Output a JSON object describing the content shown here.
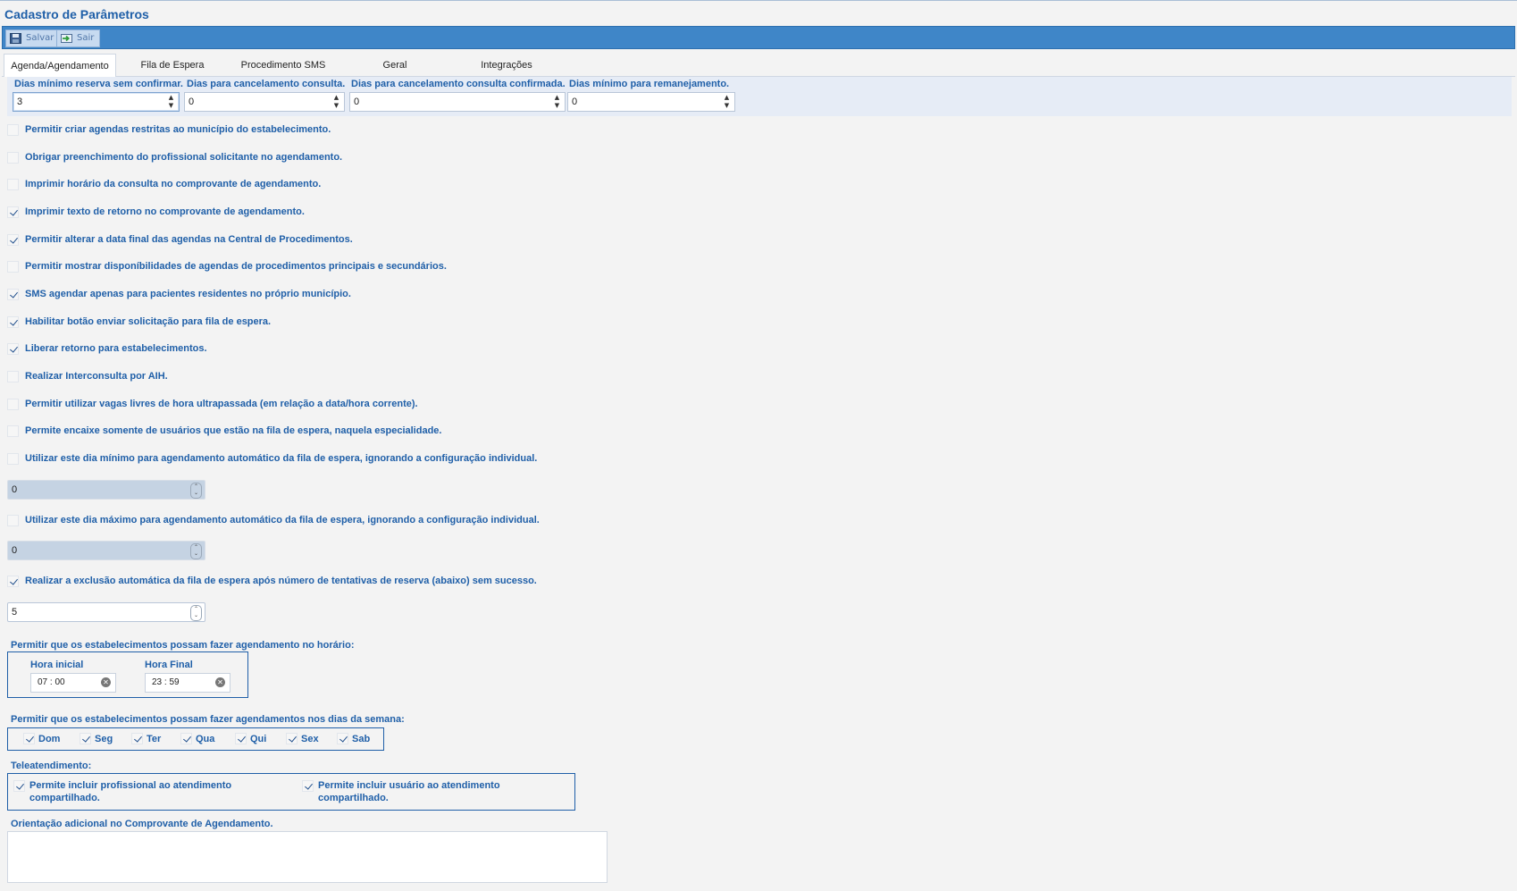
{
  "window": {
    "title": "Cadastro de Parâmetros"
  },
  "toolbar": {
    "save_label": "Salvar",
    "exit_label": "Sair"
  },
  "tabs": [
    {
      "label": "Agenda/Agendamento",
      "active": true
    },
    {
      "label": "Fila de Espera",
      "active": false
    },
    {
      "label": "Procedimento SMS",
      "active": false
    },
    {
      "label": "Geral",
      "active": false
    },
    {
      "label": "Integrações",
      "active": false
    }
  ],
  "params": {
    "min_reserve_label": "Dias mínimo reserva sem confirmar.",
    "min_reserve_value": "3",
    "cancel_label": "Dias para cancelamento consulta.",
    "cancel_value": "0",
    "cancel_confirmed_label": "Dias para cancelamento consulta confirmada.",
    "cancel_confirmed_value": "0",
    "relocation_label": "Dias mínimo para remanejamento.",
    "relocation_value": "0"
  },
  "options": [
    {
      "label": "Permitir criar agendas restritas ao município do estabelecimento.",
      "checked": false
    },
    {
      "label": "Obrigar preenchimento do profissional solicitante no agendamento.",
      "checked": false
    },
    {
      "label": "Imprimir horário da consulta no comprovante de agendamento.",
      "checked": false
    },
    {
      "label": "Imprimir texto de retorno no comprovante de agendamento.",
      "checked": true
    },
    {
      "label": "Permitir alterar a data final das agendas na Central de Procedimentos.",
      "checked": true
    },
    {
      "label": "Permitir mostrar disponíbilidades de agendas de procedimentos principais e secundários.",
      "checked": false
    },
    {
      "label": "SMS agendar apenas para pacientes residentes no próprio município.",
      "checked": true
    },
    {
      "label": "Habilitar botão enviar solicitação para fila de espera.",
      "checked": true
    },
    {
      "label": "Liberar retorno para estabelecimentos.",
      "checked": true
    },
    {
      "label": "Realizar Interconsulta por AIH.",
      "checked": false
    },
    {
      "label": "Permitir utilizar vagas livres de hora ultrapassada (em relação a data/hora corrente).",
      "checked": false
    },
    {
      "label": "Permite encaixe somente de usuários que estão na fila de espera, naquela especialidade.",
      "checked": false
    }
  ],
  "auto_min": {
    "label": "Utilizar este dia mínimo para agendamento automático da fila de espera, ignorando a configuração individual.",
    "checked": false,
    "value": "0"
  },
  "auto_max": {
    "label": "Utilizar este dia máximo para agendamento automático da fila de espera, ignorando a configuração individual.",
    "checked": false,
    "value": "0"
  },
  "auto_exclude": {
    "label": "Realizar a exclusão automática da fila de espera após número de tentativas de reserva (abaixo) sem sucesso.",
    "checked": true,
    "value": "5"
  },
  "schedule_hours": {
    "label": "Permitir que os estabelecimentos possam fazer agendamento no horário:",
    "start_label": "Hora inicial",
    "start_value": "07 : 00",
    "end_label": "Hora Final",
    "end_value": "23 : 59"
  },
  "weekdays": {
    "label": "Permitir que os estabelecimentos possam fazer agendamentos nos dias da semana:",
    "days": [
      {
        "label": "Dom",
        "checked": true
      },
      {
        "label": "Seg",
        "checked": true
      },
      {
        "label": "Ter",
        "checked": true
      },
      {
        "label": "Qua",
        "checked": true
      },
      {
        "label": "Qui",
        "checked": true
      },
      {
        "label": "Sex",
        "checked": true
      },
      {
        "label": "Sab",
        "checked": true
      }
    ]
  },
  "teleatendimento": {
    "label": "Teleatendimento:",
    "professional_line1": "Permite incluir profissional ao atendimento",
    "professional_line2": "compartilhado.",
    "professional_checked": true,
    "user_line1": "Permite incluir usuário ao atendimento",
    "user_line2": "compartilhado.",
    "user_checked": true
  },
  "orientation": {
    "label": "Orientação adicional no Comprovante de Agendamento.",
    "value": ""
  },
  "colors": {
    "toolbar": "#3f86c8",
    "label_blue": "#1f5fa8",
    "panel_bg": "#f3f3f3",
    "param_bg": "#e6ecf6"
  }
}
